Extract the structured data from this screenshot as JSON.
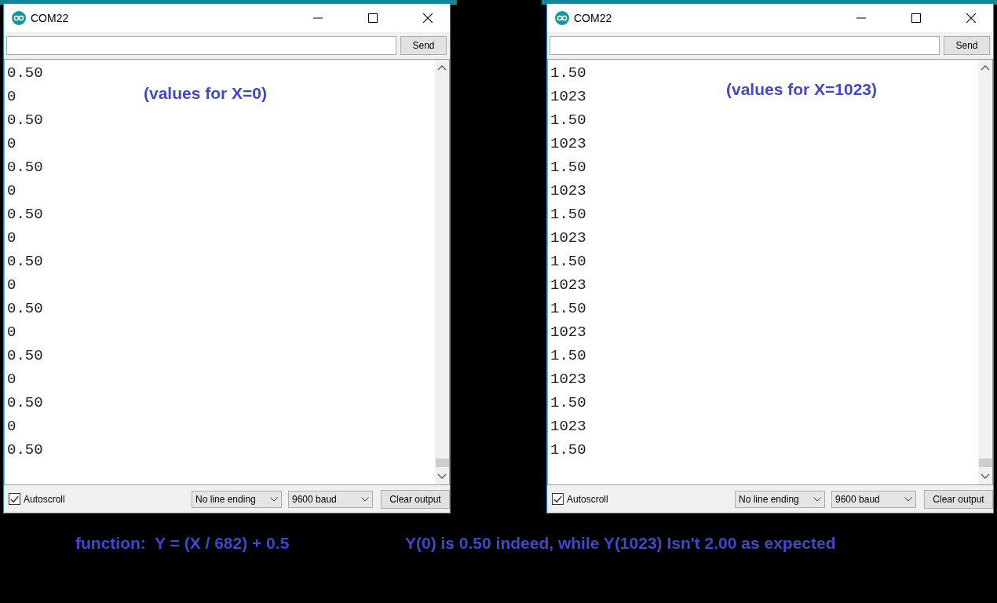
{
  "windows": [
    {
      "title": "COM22",
      "send_button": "Send",
      "output_lines": [
        "0.50",
        "0",
        "0.50",
        "0",
        "0.50",
        "0",
        "0.50",
        "0",
        "0.50",
        "0",
        "0.50",
        "0",
        "0.50",
        "0",
        "0.50",
        "0",
        "0.50"
      ],
      "annotation": "(values for X=0)",
      "autoscroll": {
        "label": "Autoscroll",
        "checked": true
      },
      "line_ending": "No line ending",
      "baud": "9600 baud",
      "clear_button": "Clear output"
    },
    {
      "title": "COM22",
      "send_button": "Send",
      "output_lines": [
        "1.50",
        "1023",
        "1.50",
        "1023",
        "1.50",
        "1023",
        "1.50",
        "1023",
        "1.50",
        "1023",
        "1.50",
        "1023",
        "1.50",
        "1023",
        "1.50",
        "1023",
        "1.50"
      ],
      "annotation": "(values for X=1023)",
      "autoscroll": {
        "label": "Autoscroll",
        "checked": true
      },
      "line_ending": "No line ending",
      "baud": "9600 baud",
      "clear_button": "Clear output"
    }
  ],
  "captions": [
    "function:  Y = (X / 682) + 0.5",
    "Y(0) is 0.50 indeed, while Y(1023) Isn't 2.00 as expected"
  ]
}
